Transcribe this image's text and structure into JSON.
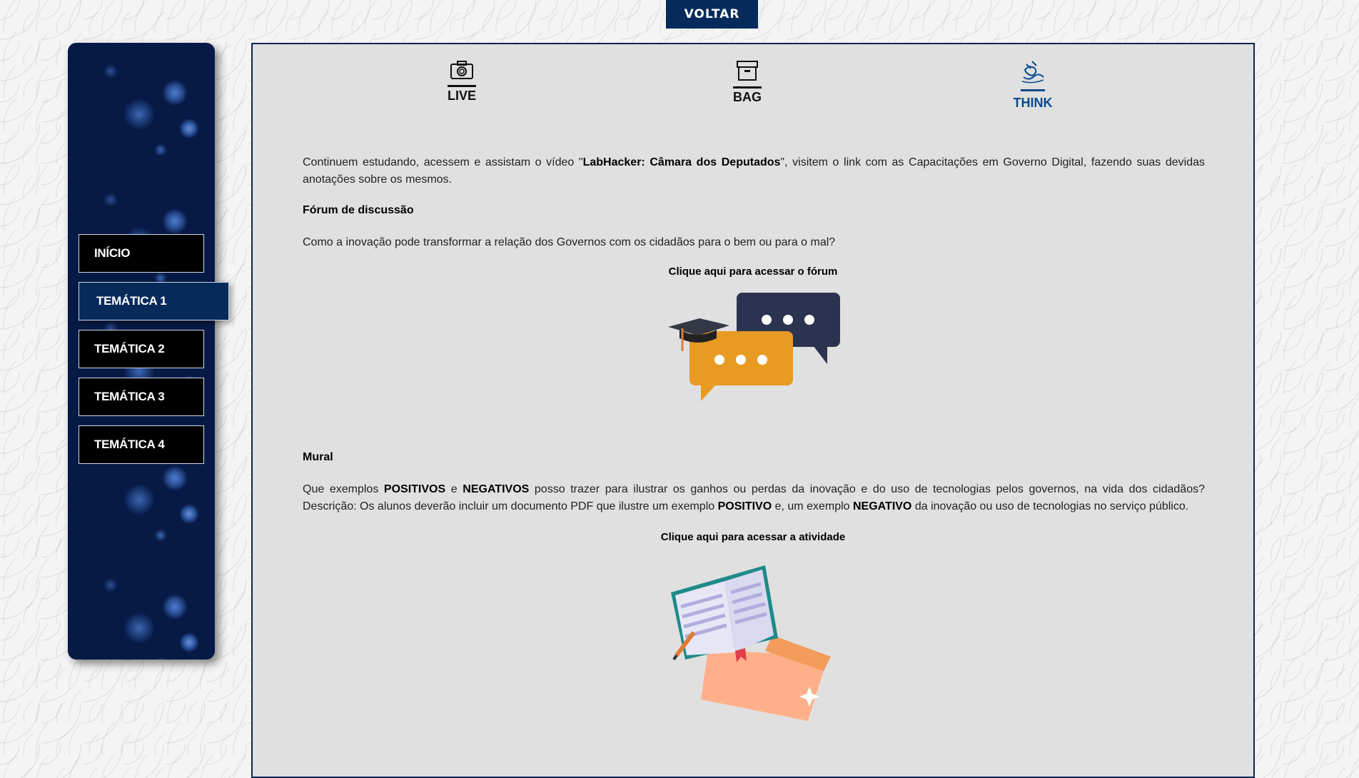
{
  "header": {
    "back_label": "VOLTAR"
  },
  "sidebar": {
    "items": [
      {
        "label": "INÍCIO"
      },
      {
        "label": "TEMÁTICA 1",
        "active": true
      },
      {
        "label": "TEMÁTICA 2"
      },
      {
        "label": "TEMÁTICA 3"
      },
      {
        "label": "TEMÁTICA 4"
      }
    ]
  },
  "tabs": [
    {
      "label": "LIVE",
      "icon": "camera-icon"
    },
    {
      "label": "BAG",
      "icon": "archive-box-icon"
    },
    {
      "label": "THINK",
      "icon": "plug-brain-icon",
      "active": true
    }
  ],
  "main": {
    "intro": {
      "p1": "Continuem estudando, acessem e assistam o vídeo \"",
      "video_title": "LabHacker: Câmara dos Deputados",
      "p2": "\", visitem o link com as Capacitações em Governo Digital, fazendo suas devidas anotações sobre os mesmos."
    },
    "forum": {
      "heading": "Fórum de discussão",
      "question": "Como a inovação pode transformar a relação dos Governos com os cidadãos para o bem ou para o mal?",
      "link_label": "Clique aqui para acessar o fórum"
    },
    "mural": {
      "heading": "Mural",
      "q1": "Que exemplos ",
      "positivos": "POSITIVOS",
      "q2": " e ",
      "negativos": "NEGATIVOS",
      "q3": " posso trazer para ilustrar os ganhos ou perdas da inovação e do uso de tecnologias pelos governos, na vida dos cidadãos? Descrição: Os alunos deverão incluir um documento PDF que ilustre um exemplo ",
      "positivo": "POSITIVO",
      "q4": " e, um exemplo ",
      "negativo": "NEGATIVO",
      "q5": " da inovação ou uso de tecnologias no serviço público.",
      "link_label": "Clique aqui para acessar a atividade"
    }
  },
  "colors": {
    "navy": "#062a5a",
    "accent_blue": "#0a4a8f",
    "panel_bg": "#e0e0e0",
    "bubble_orange": "#e89b22",
    "bubble_dark": "#2c3350"
  }
}
